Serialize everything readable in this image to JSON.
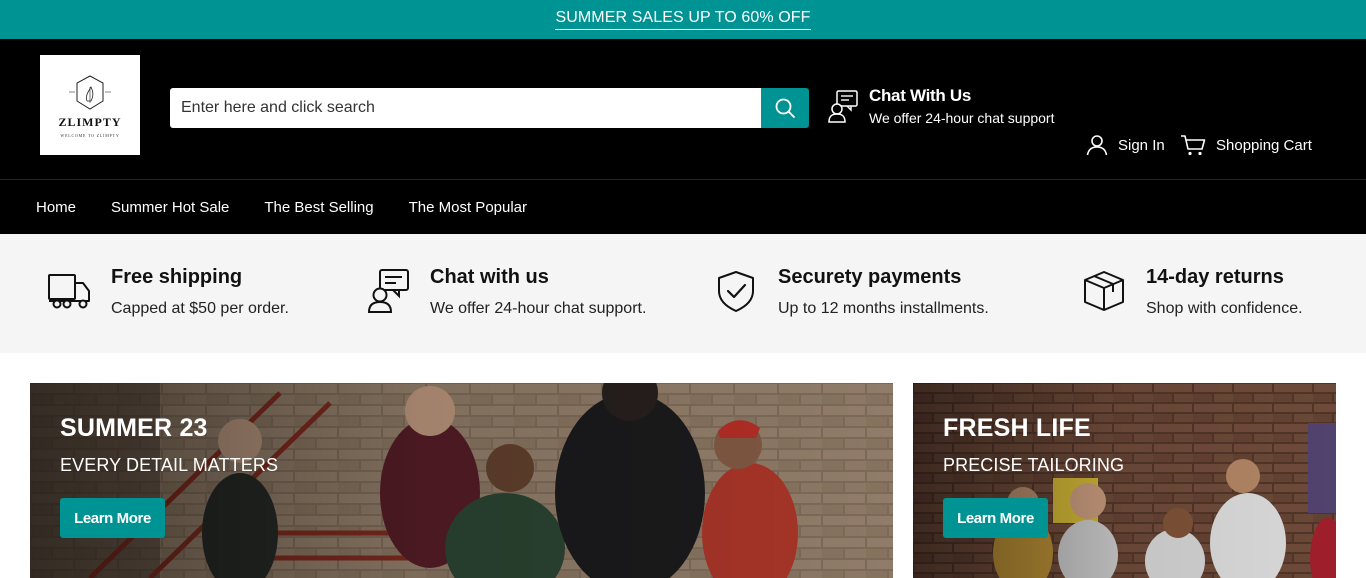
{
  "promo_bar": {
    "text": "SUMMER SALES UP TO 60% OFF",
    "bg_color": "#009393"
  },
  "header": {
    "logo": {
      "name": "ZLIMPTY",
      "tagline": "WELCOME TO ZLIMPTY"
    },
    "search": {
      "placeholder": "Enter here and click search",
      "value": "",
      "icon": "search-icon"
    },
    "chat": {
      "title": "Chat With Us",
      "subtitle": "We offer 24-hour chat support",
      "icon": "chat-support-icon"
    },
    "sign_in": {
      "label": "Sign In",
      "icon": "user-icon"
    },
    "cart": {
      "label": "Shopping Cart",
      "icon": "cart-icon"
    }
  },
  "nav": {
    "items": [
      "Home",
      "Summer Hot Sale",
      "The Best Selling",
      "The Most Popular"
    ]
  },
  "features": [
    {
      "icon": "truck-icon",
      "title": "Free shipping",
      "text": "Capped at $50 per order."
    },
    {
      "icon": "chat-support-icon",
      "title": "Chat with us",
      "text": "We offer 24-hour chat support."
    },
    {
      "icon": "shield-check-icon",
      "title": "Securety payments",
      "text": "Up to 12 months installments."
    },
    {
      "icon": "box-icon",
      "title": "14-day returns",
      "text": "Shop with confidence."
    }
  ],
  "banners": [
    {
      "title": "SUMMER 23",
      "subtitle": "EVERY DETAIL MATTERS",
      "button": "Learn More"
    },
    {
      "title": "FRESH LIFE",
      "subtitle": "PRECISE TAILORING",
      "button": "Learn More"
    }
  ],
  "colors": {
    "accent": "#009393",
    "header_bg": "#000000",
    "features_bg": "#f5f5f5"
  }
}
